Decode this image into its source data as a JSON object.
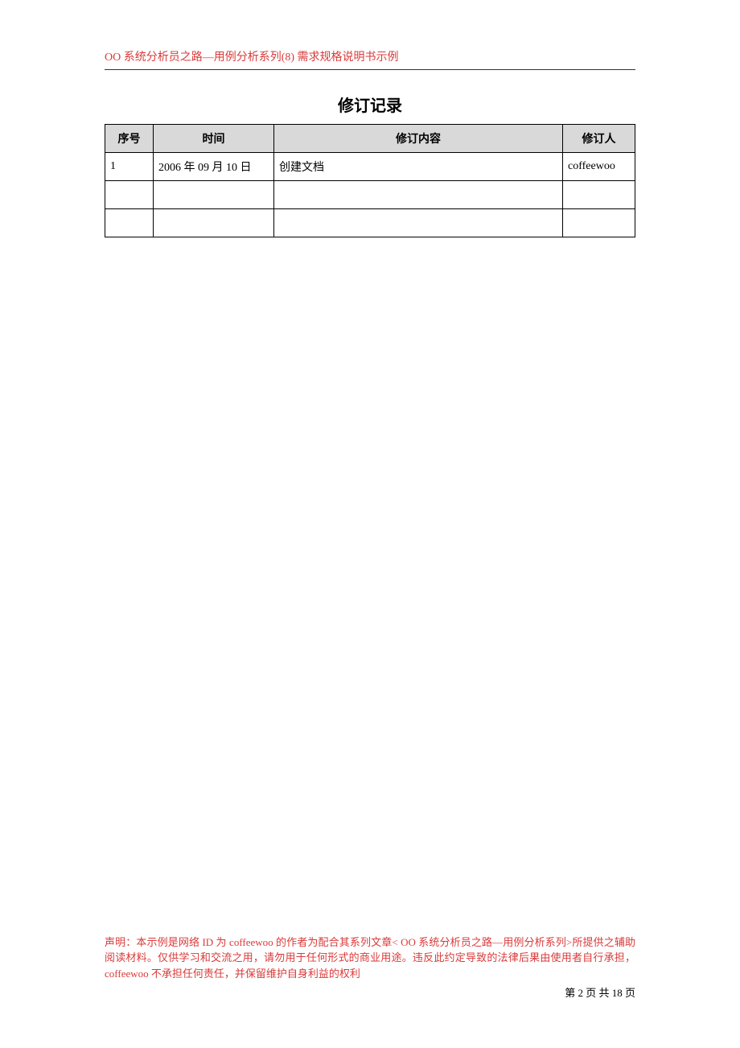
{
  "header": {
    "title": "OO 系统分析员之路—用例分析系列(8)  需求规格说明书示例"
  },
  "section": {
    "title": "修订记录"
  },
  "table": {
    "columns": [
      "序号",
      "时间",
      "修订内容",
      "修订人"
    ],
    "rows": [
      {
        "seq": "1",
        "time": "2006 年 09 月 10 日",
        "content": "创建文档",
        "person": "coffeewoo"
      },
      {
        "seq": "",
        "time": "",
        "content": "",
        "person": ""
      },
      {
        "seq": "",
        "time": "",
        "content": "",
        "person": ""
      }
    ]
  },
  "footer": {
    "disclaimer": "声明：本示例是网络 ID 为 coffeewoo 的作者为配合其系列文章< OO 系统分析员之路—用例分析系列>所提供之辅助阅读材料。仅供学习和交流之用，请勿用于任何形式的商业用途。违反此约定导致的法律后果由使用者自行承担，coffeewoo 不承担任何责任，并保留维护自身利益的权利",
    "page_number": "第 2 页 共 18 页",
    "overlay_char": "2"
  }
}
